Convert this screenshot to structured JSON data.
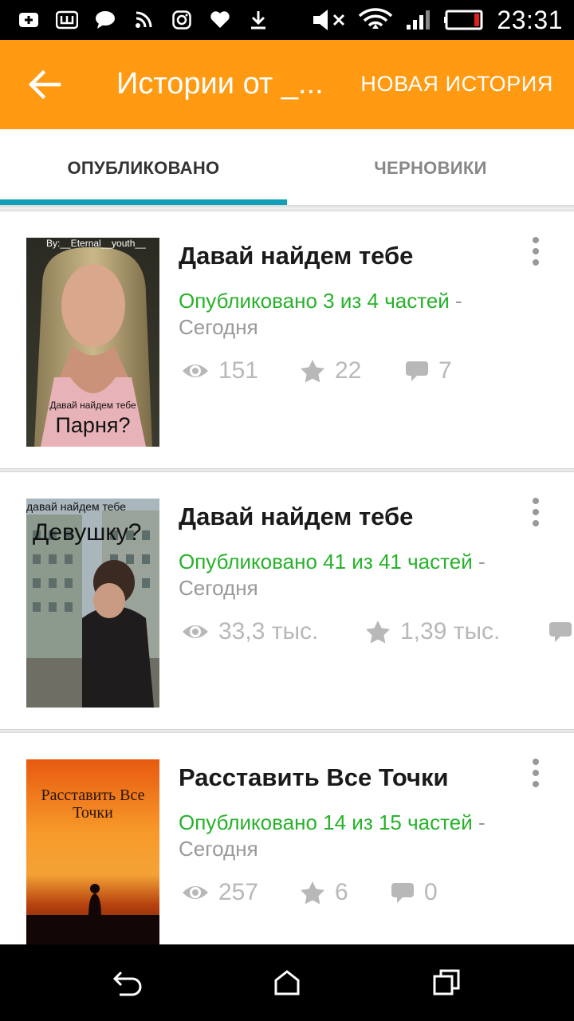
{
  "status_bar": {
    "time": "23:31",
    "icons": [
      "add-box-icon",
      "app-w-icon",
      "chat-bubble-icon",
      "rss-icon",
      "instagram-icon",
      "heart-icon",
      "download-icon",
      "volume-mute-icon",
      "wifi-icon",
      "signal-icon",
      "battery-icon"
    ]
  },
  "appbar": {
    "title": "Истории от _...",
    "new_story_label": "НОВАЯ ИСТОРИЯ",
    "background": "#ff9a12"
  },
  "tabs": {
    "published": "ОПУБЛИКОВАНО",
    "drafts": "ЧЕРНОВИКИ",
    "indicator_color": "#10a0b8"
  },
  "stories": [
    {
      "title": "Давай найдем тебе",
      "status_published": "Опубликовано 3 из 4 частей",
      "status_separator": " -",
      "status_date": "Сегодня",
      "views": "151",
      "votes": "22",
      "comments": "7",
      "cover": {
        "top_text": "By:__Eternal__youth__",
        "line1": "Давай найдем тебе",
        "line2": "Парня?"
      }
    },
    {
      "title": "Давай найдем тебе",
      "status_published": "Опубликовано 41 из 41 частей",
      "status_separator": " -",
      "status_date": "Сегодня",
      "views": "33,3 тыс.",
      "votes": "1,39 тыс.",
      "cover": {
        "line1": "давай найдем тебе",
        "line2": "Девушку?"
      }
    },
    {
      "title": "Расставить Все Точки",
      "status_published": "Опубликовано 14 из 15 частей",
      "status_separator": " -",
      "status_date": "Сегодня",
      "views": "257",
      "votes": "6",
      "comments": "0",
      "cover": {
        "line1": "Расставить Все",
        "line2": "Точки"
      }
    }
  ],
  "colors": {
    "published_green": "#27b22a",
    "stat_gray": "#b8b8b8"
  }
}
